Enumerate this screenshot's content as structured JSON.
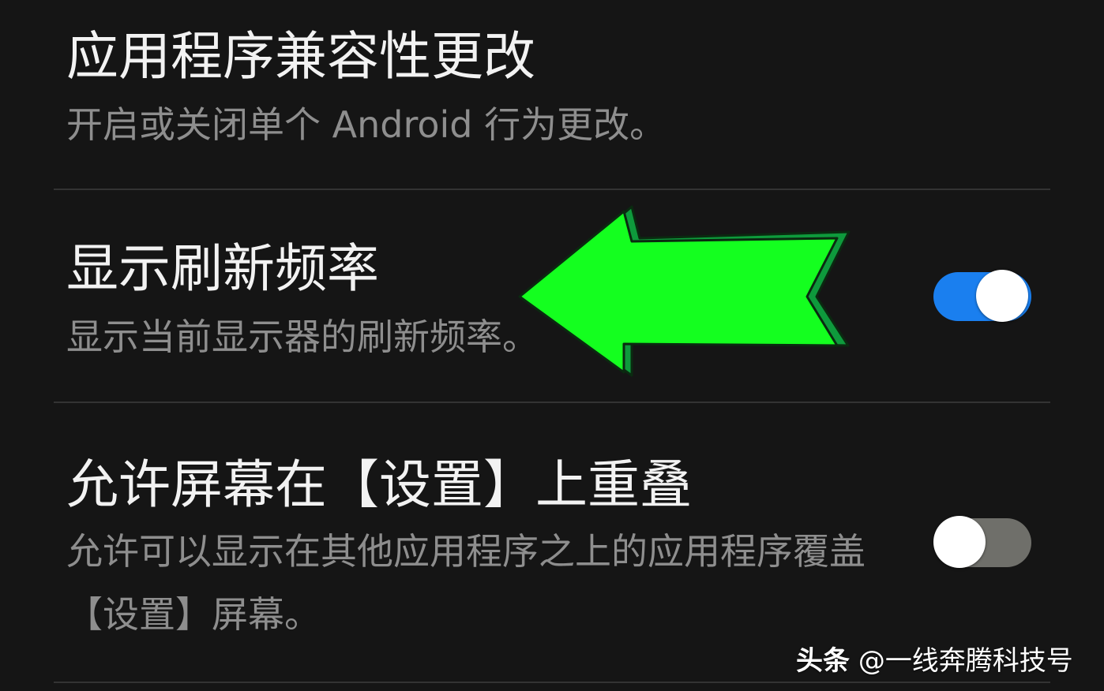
{
  "settings": [
    {
      "title": "应用程序兼容性更改",
      "subtitle": "开启或关闭单个 Android 行为更改。"
    },
    {
      "title": "显示刷新频率",
      "subtitle": "显示当前显示器的刷新频率。",
      "toggle_on": true
    },
    {
      "title": "允许屏幕在【设置】上重叠",
      "subtitle": "允许可以显示在其他应用程序之上的应用程序覆盖【设置】屏幕。",
      "toggle_on": false
    }
  ],
  "colors": {
    "toggle_on_track": "#1a7fef",
    "toggle_off_track": "#6f6f6a",
    "arrow_fill": "#14ff1f",
    "arrow_shadow": "#0e9a3c"
  },
  "watermark": {
    "brand": "头条",
    "author": "@一线奔腾科技号"
  }
}
